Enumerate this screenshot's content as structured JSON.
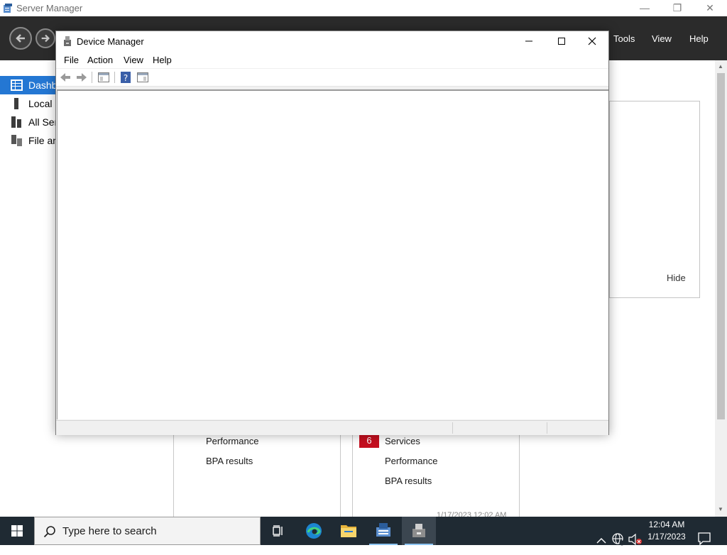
{
  "server_manager": {
    "title": "Server Manager",
    "header_menu": [
      "Tools",
      "View",
      "Help"
    ],
    "sidebar": [
      {
        "label": "Dashb",
        "icon": "dashboard-icon",
        "active": true
      },
      {
        "label": "Local S",
        "icon": "server-icon",
        "active": false
      },
      {
        "label": "All Ser",
        "icon": "servers-icon",
        "active": false
      },
      {
        "label": "File an",
        "icon": "file-storage-icon",
        "active": false
      }
    ],
    "panel_hide": "Hide",
    "tiles": [
      {
        "rows": [
          "Performance",
          "BPA results"
        ]
      },
      {
        "badge": "6",
        "rows": [
          "Services",
          "Performance",
          "BPA results"
        ]
      }
    ],
    "tile_timestamp": "1/17/2023 12:02 AM"
  },
  "device_manager": {
    "title": "Device Manager",
    "menu": [
      "File",
      "Action",
      "View",
      "Help"
    ]
  },
  "taskbar": {
    "search_placeholder": "Type here to search",
    "clock_time": "12:04 AM",
    "clock_date": "1/17/2023"
  },
  "colors": {
    "accent": "#2477d3",
    "header_bg": "#2b2b2b",
    "badge_red": "#c50f1f",
    "taskbar_bg": "#1f2a33"
  }
}
